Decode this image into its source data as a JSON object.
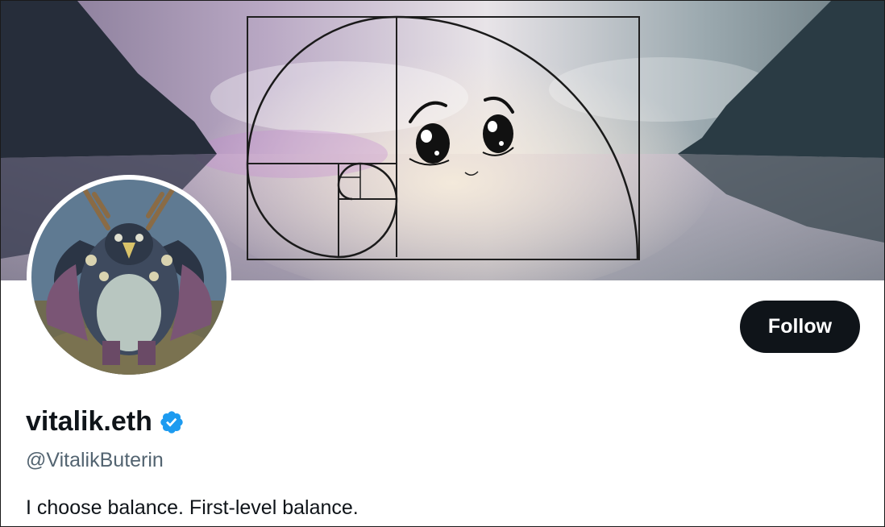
{
  "profile": {
    "display_name": "vitalik.eth",
    "handle": "@VitalikButerin",
    "bio": "I choose balance. First-level balance.",
    "follow_label": "Follow",
    "verified_icon": "verified-badge-icon"
  },
  "colors": {
    "follow_bg": "#0f1419",
    "follow_text": "#ffffff",
    "name_text": "#0f1419",
    "handle_text": "#536471",
    "verified_blue": "#1d9bf0"
  }
}
